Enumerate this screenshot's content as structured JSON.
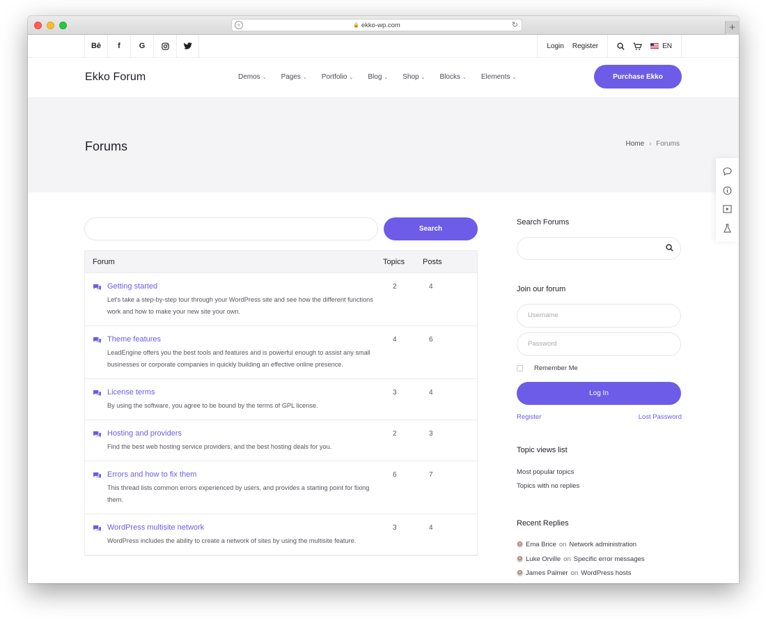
{
  "browser": {
    "url": "ekko-wp.com"
  },
  "topbar": {
    "social": [
      "Bē",
      "f",
      "G",
      "◎",
      "🐦"
    ],
    "login": "Login",
    "register": "Register",
    "language": "EN"
  },
  "header": {
    "logo": "Ekko Forum",
    "nav": [
      "Demos",
      "Pages",
      "Portfolio",
      "Blog",
      "Shop",
      "Blocks",
      "Elements"
    ],
    "cta": "Purchase Ekko"
  },
  "hero": {
    "title": "Forums",
    "breadcrumb_home": "Home",
    "breadcrumb_sep": "›",
    "breadcrumb_current": "Forums"
  },
  "search": {
    "button": "Search"
  },
  "forum_table": {
    "col_forum": "Forum",
    "col_topics": "Topics",
    "col_posts": "Posts",
    "rows": [
      {
        "title": "Getting started",
        "desc": "Let's take a step-by-step tour through your WordPress site and see how the different functions work and how to make your new site your own.",
        "topics": "2",
        "posts": "4"
      },
      {
        "title": "Theme features",
        "desc": "LeadEngine offers you the best tools and features and is powerful enough to assist any small businesses or corporate companies in quickly building an effective online presence.",
        "topics": "4",
        "posts": "6"
      },
      {
        "title": "License terms",
        "desc": "By using the software, you agree to be bound by the terms of GPL license.",
        "topics": "3",
        "posts": "4"
      },
      {
        "title": "Hosting and providers",
        "desc": "Find the best web hosting service providers, and the best hosting deals for you.",
        "topics": "2",
        "posts": "3"
      },
      {
        "title": "Errors and how to fix them",
        "desc": "This thread lists common errors experienced by users, and provides a starting point for fixing them.",
        "topics": "6",
        "posts": "7"
      },
      {
        "title": "WordPress multisite network",
        "desc": "WordPress includes the ability to create a network of sites by using the multisite feature.",
        "topics": "3",
        "posts": "4"
      }
    ]
  },
  "sidebar": {
    "search_title": "Search Forums",
    "join_title": "Join our forum",
    "username_placeholder": "Username",
    "password_placeholder": "Password",
    "remember": "Remember Me",
    "login_button": "Log In",
    "register_link": "Register",
    "lost_password_link": "Lost Password",
    "topic_views_title": "Topic views list",
    "topic_views": [
      "Most popular topics",
      "Topics with no replies"
    ],
    "recent_replies_title": "Recent Replies",
    "recent_replies": [
      {
        "user": "Ema Brice",
        "on": "on",
        "topic": "Network administration"
      },
      {
        "user": "Luke Orville",
        "on": "on",
        "topic": "Specific error messages"
      },
      {
        "user": "James Palmer",
        "on": "on",
        "topic": "WordPress hosts"
      }
    ]
  },
  "theme": {
    "accent": "#6c5ce7"
  }
}
